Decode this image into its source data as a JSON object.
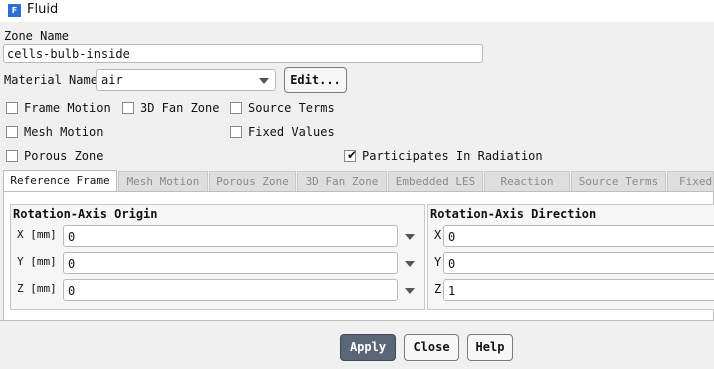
{
  "window": {
    "title": "Fluid",
    "icon_letter": "F"
  },
  "zone": {
    "label": "Zone Name",
    "value": "cells-bulb-inside"
  },
  "material": {
    "label": "Material Name",
    "value": "air",
    "edit_label": "Edit..."
  },
  "options": [
    {
      "label": "Frame Motion",
      "checked": false
    },
    {
      "label": "3D Fan Zone",
      "checked": false
    },
    {
      "label": "Source Terms",
      "checked": false
    },
    {
      "label": "Mesh Motion",
      "checked": false
    },
    {
      "label": "Fixed Values",
      "checked": false
    },
    {
      "label": "Porous Zone",
      "checked": false
    },
    {
      "label": "Participates In Radiation",
      "checked": true
    }
  ],
  "tabs": [
    {
      "label": "Reference Frame",
      "active": true
    },
    {
      "label": "Mesh Motion",
      "active": false
    },
    {
      "label": "Porous Zone",
      "active": false
    },
    {
      "label": "3D Fan Zone",
      "active": false
    },
    {
      "label": "Embedded LES",
      "active": false
    },
    {
      "label": "Reaction",
      "active": false
    },
    {
      "label": "Source Terms",
      "active": false
    },
    {
      "label": "Fixed",
      "active": false
    }
  ],
  "origin": {
    "title": "Rotation-Axis Origin",
    "rows": [
      {
        "label": "X [mm]",
        "value": "0"
      },
      {
        "label": "Y [mm]",
        "value": "0"
      },
      {
        "label": "Z [mm]",
        "value": "0"
      }
    ]
  },
  "direction": {
    "title": "Rotation-Axis Direction",
    "rows": [
      {
        "label": "X",
        "value": "0"
      },
      {
        "label": "Y",
        "value": "0"
      },
      {
        "label": "Z",
        "value": "1"
      }
    ]
  },
  "buttons": {
    "apply": "Apply",
    "close": "Close",
    "help": "Help"
  },
  "colors": {
    "accent": "#2f6fd3",
    "apply_bg": "#5a6675"
  }
}
